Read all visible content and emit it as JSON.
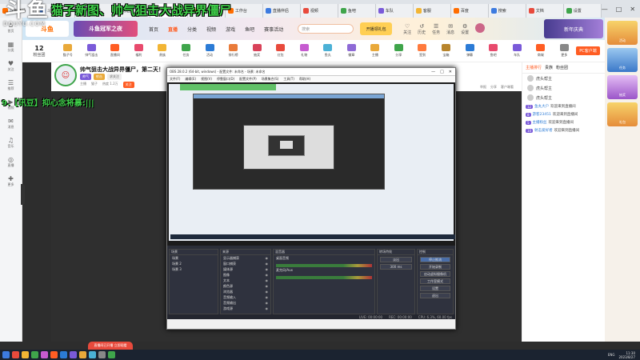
{
  "overlay": {
    "logo_big": "斗鱼",
    "logo_small": "DOUYU.COM",
    "title": "猫子新图、帅气狙击大战异界僵尸",
    "danmu": "9.【讯豆】抑心念将慕:|||"
  },
  "browser": {
    "tabs": [
      "斗鱼直播",
      "斗鱼",
      "我的直播",
      "分区",
      "猫子新图",
      "直播间",
      "工作台",
      "直播伴侣",
      "视频",
      "鱼吧",
      "车队",
      "客服",
      "百度",
      "搜索",
      "文档",
      "设置"
    ],
    "window_controls": [
      "—",
      "□",
      "✕"
    ]
  },
  "leftnav": {
    "items": [
      {
        "glyph": "⌂",
        "label": "首页"
      },
      {
        "glyph": "▦",
        "label": "分类"
      },
      {
        "glyph": "♥",
        "label": "关注"
      },
      {
        "glyph": "☰",
        "label": "推荐"
      },
      {
        "glyph": "▶",
        "label": "视频"
      },
      {
        "glyph": "✉",
        "label": "消息"
      },
      {
        "glyph": "♫",
        "label": "音乐"
      },
      {
        "glyph": "◎",
        "label": "直播"
      },
      {
        "glyph": "✚",
        "label": "更多"
      }
    ]
  },
  "topnav": {
    "logo": "斗鱼",
    "banner": "斗鱼冠军之夜",
    "links": [
      "首页",
      "直播",
      "分类",
      "视频",
      "游戏",
      "鱼吧",
      "赛事活动"
    ],
    "active_link": "直播",
    "search_placeholder": "搜索",
    "promo": "开播领礼包",
    "icons": [
      {
        "glyph": "♡",
        "label": "关注"
      },
      {
        "glyph": "↺",
        "label": "历史"
      },
      {
        "glyph": "☰",
        "label": "任务"
      },
      {
        "glyph": "✉",
        "label": "消息"
      },
      {
        "glyph": "⚙",
        "label": "设置"
      }
    ],
    "right_banner": "新年庆典"
  },
  "iconrow": {
    "fans_number": "12",
    "fans_label": "粉丝团",
    "items": [
      {
        "label": "猫子号",
        "color": "#e9a93a"
      },
      {
        "label": "帅气狙击",
        "color": "#7a5ad9"
      },
      {
        "label": "直播间",
        "color": "#ff5d23"
      },
      {
        "label": "福利",
        "color": "#e84a6d"
      },
      {
        "label": "贵族",
        "color": "#f2b534"
      },
      {
        "label": "任务",
        "color": "#3fa54b"
      },
      {
        "label": "活动",
        "color": "#2b7bd6"
      },
      {
        "label": "排行榜",
        "color": "#e97b3a"
      },
      {
        "label": "抽奖",
        "color": "#d9435a"
      },
      {
        "label": "红包",
        "color": "#e84a3c"
      },
      {
        "label": "礼物",
        "color": "#c65bd0"
      },
      {
        "label": "鱼丸",
        "color": "#4bb1d6"
      },
      {
        "label": "徽章",
        "color": "#8e6ad6"
      },
      {
        "label": "主播",
        "color": "#e9a93a"
      },
      {
        "label": "分享",
        "color": "#3fa54b"
      },
      {
        "label": "签到",
        "color": "#ff7a3d"
      },
      {
        "label": "宝箱",
        "color": "#b8852c"
      },
      {
        "label": "弹幕",
        "color": "#2b7bd6"
      },
      {
        "label": "鱼吧",
        "color": "#e84a6d"
      },
      {
        "label": "车队",
        "color": "#7a5ad9"
      },
      {
        "label": "商城",
        "color": "#ff5d23"
      },
      {
        "label": "更多",
        "color": "#888888"
      }
    ],
    "pc_button": "PC客户端"
  },
  "room": {
    "title": "帅气狙击大战异界僵尸，第二天！",
    "tags": [
      "帅气",
      "射击",
      "求关注"
    ],
    "meta": [
      "主播",
      "猫子",
      "热度 1.2万"
    ],
    "follow_button": "关注",
    "actions": [
      "举报",
      "分享",
      "客户端看"
    ]
  },
  "obs": {
    "title": "OBS 28.0.2 (64-bit, windows) - 配置文件: 未命名 - 场景: 未命名",
    "menu": [
      "文件(F)",
      "编辑(E)",
      "视图(V)",
      "停靠窗口(D)",
      "配置文件(P)",
      "场景集合(S)",
      "工具(T)",
      "帮助(H)"
    ],
    "window_controls": [
      "—",
      "□",
      "✕"
    ],
    "scenes_header": "场景",
    "scenes": [
      "场景",
      "场景 2",
      "场景 3"
    ],
    "sources_header": "来源",
    "sources": [
      "显示器捕获",
      "窗口捕获",
      "媒体源",
      "图像",
      "文本",
      "颜色源",
      "浏览器",
      "音频输入",
      "音频输出",
      "游戏源"
    ],
    "mixer_header": "混音器",
    "mixer_tracks": [
      "桌面音频",
      "麦克风/Aux"
    ],
    "transitions_header": "转场特效",
    "transition_value": "淡出",
    "transition_duration": "300 ms",
    "controls_header": "控制",
    "controls": [
      "停止推流",
      "开始录制",
      "启动虚拟摄像机",
      "工作室模式",
      "设置",
      "退出"
    ],
    "status": [
      "LIVE: 00:00:00",
      "REC: 00:00:00",
      "CPU: 6.3%, 60.00 fps"
    ]
  },
  "sidepanel": {
    "tabs": [
      "主播排行",
      "贵族",
      "粉丝团"
    ],
    "ranks": [
      "虎头帮主",
      "虎头帮主",
      "虎头帮主"
    ],
    "chat": [
      {
        "level": "12",
        "name": "鱼丸大户",
        "text": "欢迎来到直播间"
      },
      {
        "level": "8",
        "name": "游客23451",
        "text": "欢迎来到直播间"
      },
      {
        "level": "5",
        "name": "主播粉丝",
        "text": "欢迎来到直播间"
      },
      {
        "level": "10",
        "name": "射击爱好者",
        "text": "欢迎来到直播间"
      }
    ]
  },
  "rightcol": {
    "cards": [
      "活动",
      "任务",
      "抽奖",
      "礼包"
    ]
  },
  "toast": {
    "text": "直播间已开播 立即观看"
  },
  "taskbar": {
    "icons": [
      "#3d7be0",
      "#e84a3c",
      "#f2b534",
      "#3fa54b",
      "#c65bd0",
      "#ff5d23",
      "#2b7bd6",
      "#7a5ad9",
      "#e9a93a",
      "#4bb1d6",
      "#888888",
      "#3fa54b"
    ],
    "lang": "ENG",
    "time": "11:30",
    "date": "2023/8/27"
  }
}
